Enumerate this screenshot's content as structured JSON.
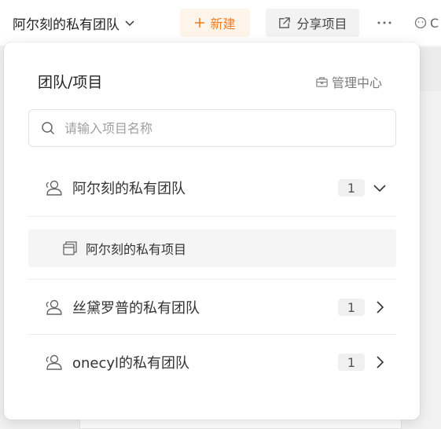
{
  "topbar": {
    "team_name": "阿尔刻的私有团队",
    "new_label": "新建",
    "share_label": "分享项目",
    "more_label": "···",
    "right_cut_label": "C"
  },
  "dropdown": {
    "title": "团队/项目",
    "admin_label": "管理中心",
    "search_placeholder": "请输入项目名称",
    "teams": [
      {
        "name": "阿尔刻的私有团队",
        "count": "1",
        "expanded": true,
        "projects": [
          {
            "name": "阿尔刻的私有项目"
          }
        ]
      },
      {
        "name": "丝黛罗普的私有团队",
        "count": "1",
        "expanded": false
      },
      {
        "name": "onecyl的私有团队",
        "count": "1",
        "expanded": false
      }
    ]
  },
  "colors": {
    "accent": "#f07c1e",
    "accent_bg": "#fff4ea"
  },
  "icons": {
    "team": "team-icon",
    "project": "project-icon",
    "search": "search-icon",
    "admin": "briefcase-icon",
    "share": "share-icon",
    "plus": "plus-icon",
    "chevron_down": "chevron-down-icon",
    "chevron_right": "chevron-right-icon"
  }
}
